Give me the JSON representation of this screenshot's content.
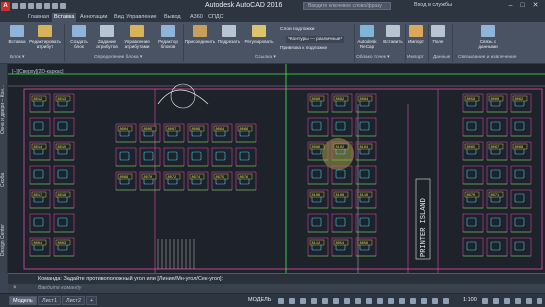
{
  "window": {
    "title": "Autodesk AutoCAD 2016",
    "search_placeholder": "Введите ключевое слово/фразу",
    "sign_in": "Вход в службы",
    "app_letter": "A"
  },
  "ribbon_tabs": [
    "Главная",
    "Вставка",
    "Аннотации",
    "Вид",
    "Управление",
    "Вывод",
    "A360",
    "СПДС"
  ],
  "ribbon": {
    "buttons": {
      "insert": "Вставка",
      "edit_attr": "Редактировать атрибут",
      "create_block": "Создать блок",
      "define_attr": "Задание атрибутов",
      "manage_attr": "Управление атрибутами",
      "block_editor": "Редактор блоков",
      "attach": "Присоединить",
      "clip": "Подрезать",
      "adjust": "Регулировать",
      "recap": "Autodesk ReCap",
      "import_pc": "Вставить",
      "import": "Импорт",
      "field": "Поле",
      "link_data": "Связь с данными"
    },
    "small": {
      "underlay_layers": "Слои подложки",
      "frames": "*Контуры — различные*",
      "snap": "Привязка к подложке"
    },
    "groups": {
      "block": "Блок ▾",
      "block_def": "Определение блока ▾",
      "reference": "Ссылка ▾",
      "point_cloud": "Облако точек ▾",
      "import": "Импорт",
      "data": "Данные",
      "linking": "Связывание и извлечение"
    }
  },
  "view_label": "[−][Сверху][2D-каркас]",
  "palettes": [
    "Окна и двери – Кон...",
    "Скоба",
    "Design Center"
  ],
  "drawing": {
    "vertical_label": "PRINTER ISLAND",
    "room_tags": [
      "8012",
      "8013",
      "8014",
      "8015",
      "8017",
      "8019",
      "8001",
      "8003",
      "8004",
      "8005",
      "8007",
      "8009",
      "8064",
      "8066",
      "8068",
      "8070",
      "8072",
      "8074",
      "8075",
      "8076",
      "8080",
      "8082",
      "8084",
      "8086",
      "8102",
      "8104",
      "8106",
      "8108",
      "8110",
      "8112",
      "8054",
      "8056",
      "8058",
      "8060",
      "8062",
      "8065",
      "8067",
      "8068",
      "8070",
      "8071"
    ]
  },
  "command": {
    "prompt": "Команда: Задайте противоположный угол или [Линия/Мн-угол/Сек-угол]:",
    "input_placeholder": "Введите команду"
  },
  "status": {
    "tabs": [
      "Модель",
      "Лист1",
      "Лист2"
    ],
    "model": "МОДЕЛЬ",
    "scale": "1:100",
    "add_tab": "+"
  },
  "colors": {
    "accent": "#e84ea8",
    "cyan": "#3fd0f0",
    "green": "#3df04a",
    "yellow": "#e8e050",
    "white": "#e8e8e8"
  }
}
